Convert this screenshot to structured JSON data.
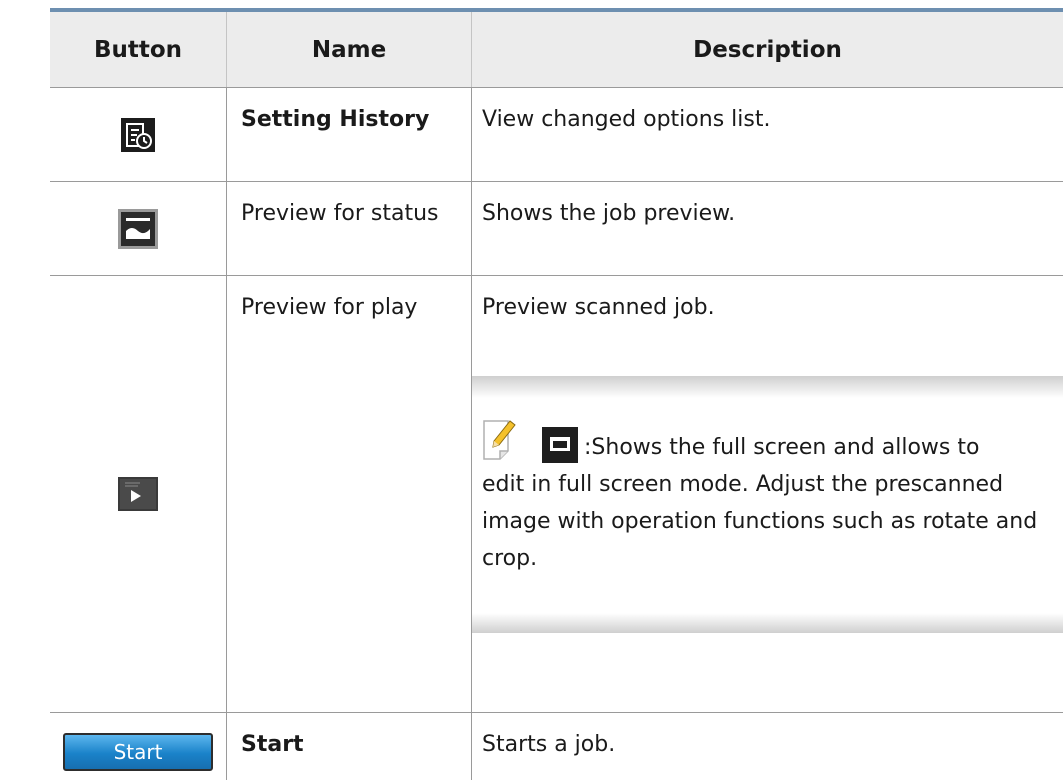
{
  "header": {
    "col_button": "Button",
    "col_name": "Name",
    "col_description": "Description"
  },
  "rows": [
    {
      "icon": "setting-history-icon",
      "name": "Setting History",
      "description": "View changed options list."
    },
    {
      "icon": "preview-status-icon",
      "name": "Preview for status",
      "description": "Shows the job preview."
    },
    {
      "icon": "preview-play-icon",
      "name": "Preview for play",
      "description": "Preview scanned job.",
      "note": {
        "icon": "note-pencil-icon",
        "line1": ":Shows the full screen and allows to",
        "rest": "edit in full screen mode. Adjust the prescanned image with operation functions such as rotate and crop."
      }
    },
    {
      "icon": "start-button",
      "button_label": "Start",
      "name": "Start",
      "description": "Starts a job."
    }
  ],
  "colors": {
    "top_rule": "#6d8fb0",
    "header_bg": "#ececec",
    "start_button": "#1a82c9"
  }
}
